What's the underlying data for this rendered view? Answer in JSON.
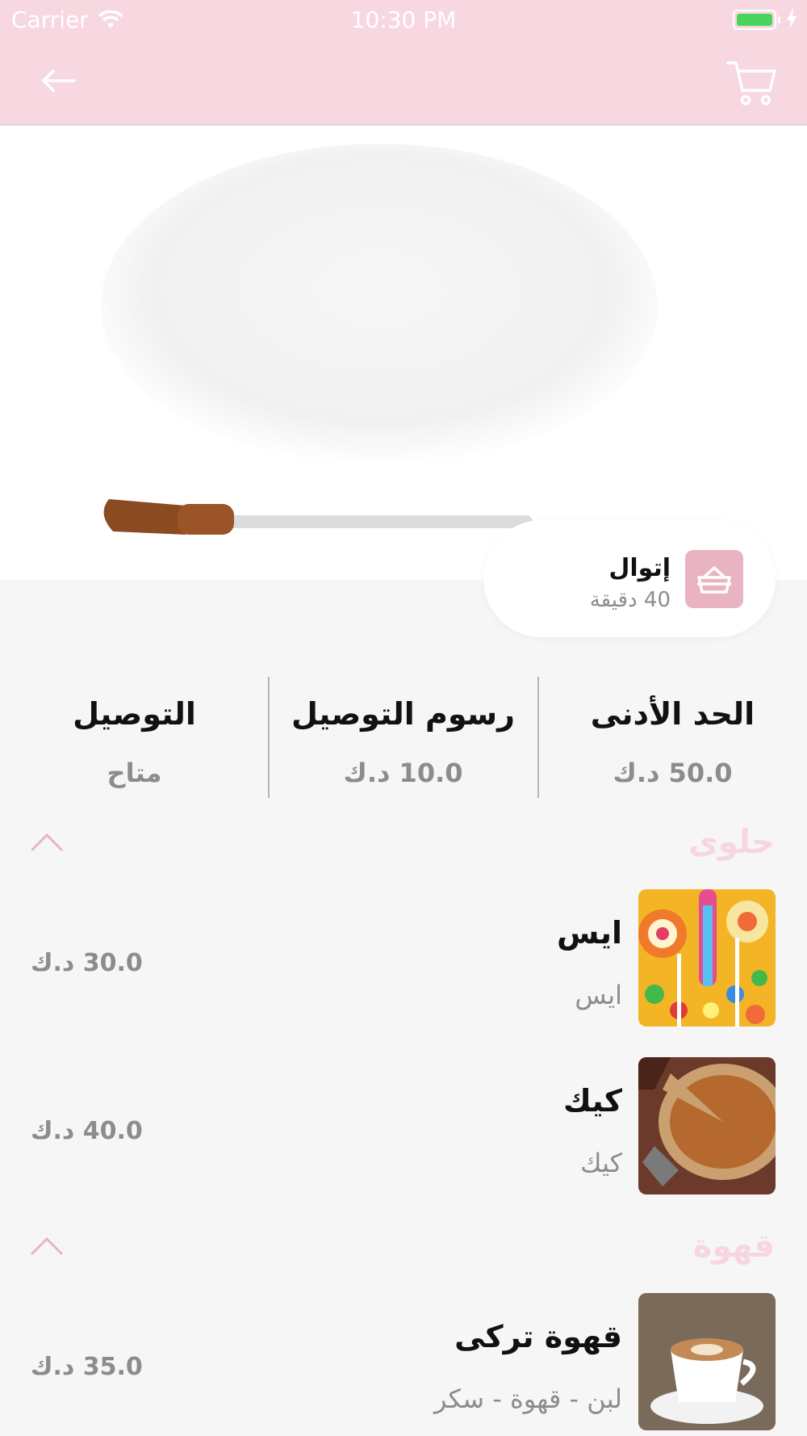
{
  "status_bar": {
    "carrier": "Carrier",
    "time": "10:30 PM"
  },
  "header": {
    "back_icon": "arrow-left-icon",
    "cart_icon": "cart-icon",
    "background_color": "#f7d8e1"
  },
  "store": {
    "name": "إتوال",
    "delivery_time": "40 دقيقة",
    "icon": "pot-icon",
    "accent_color": "#eab3c1"
  },
  "stats": [
    {
      "title": "الحد الأدنى",
      "value": "50.0 د.ك"
    },
    {
      "title": "رسوم التوصيل",
      "value": "10.0 د.ك"
    },
    {
      "title": "التوصيل",
      "value": "متاح"
    }
  ],
  "sections": [
    {
      "title": "حلوى",
      "products": [
        {
          "name": "ايس",
          "description": "ايس",
          "price": "30.0 د.ك"
        },
        {
          "name": "كيك",
          "description": "كيك",
          "price": "40.0 د.ك"
        }
      ]
    },
    {
      "title": "قهوة",
      "products": [
        {
          "name": "قهوة تركى",
          "description": "لبن - قهوة - سكر",
          "price": "35.0 د.ك"
        }
      ]
    }
  ]
}
